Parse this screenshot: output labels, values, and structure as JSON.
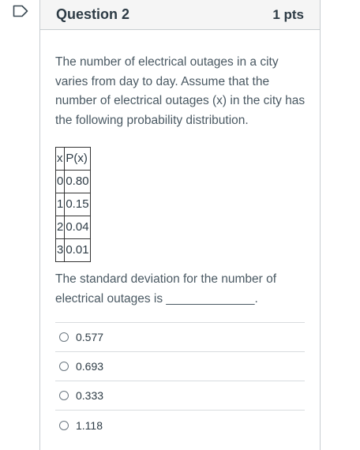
{
  "question": {
    "title": "Question 2",
    "points": "1 pts",
    "prompt": "The number of electrical outages in a city varies from day to day. Assume that the number of electrical outages (x) in the city has the following probability distribution.",
    "table": {
      "headers": [
        "x",
        "P(x)"
      ],
      "rows": [
        [
          "0",
          "0.80"
        ],
        [
          "1",
          "0.15"
        ],
        [
          "2",
          "0.04"
        ],
        [
          "3",
          "0.01"
        ]
      ]
    },
    "followup": "The standard deviation for the number of electrical outages is _____________.",
    "answers": [
      {
        "label": "0.577"
      },
      {
        "label": "0.693"
      },
      {
        "label": "0.333"
      },
      {
        "label": "1.118"
      }
    ]
  },
  "icons": {
    "flag": "flag-icon",
    "radio": "radio-unselected-icon"
  }
}
